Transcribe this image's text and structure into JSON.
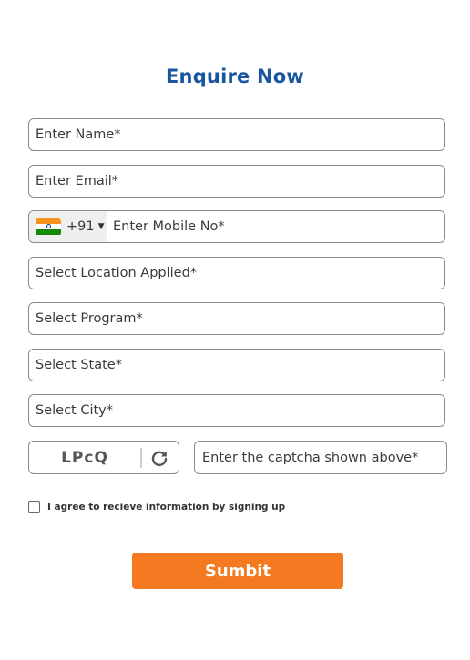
{
  "form": {
    "title": "Enquire Now",
    "name_placeholder": "Enter Name*",
    "email_placeholder": "Enter Email*",
    "dial_code": "+91",
    "mobile_placeholder": "Enter Mobile No*",
    "location_placeholder": "Select Location Applied*",
    "program_placeholder": "Select Program*",
    "state_placeholder": "Select State*",
    "city_placeholder": "Select City*",
    "captcha_code": "LPcQ",
    "captcha_placeholder": "Enter the captcha shown above*",
    "agree_label": "I agree to recieve information by signing up",
    "submit_label": "Sumbit"
  },
  "colors": {
    "title": "#1a56a0",
    "submit_bg": "#f37a20",
    "border": "#8c8c8c"
  },
  "icons": {
    "flag": "india-flag-icon",
    "caret": "caret-down-icon",
    "refresh": "refresh-icon"
  }
}
